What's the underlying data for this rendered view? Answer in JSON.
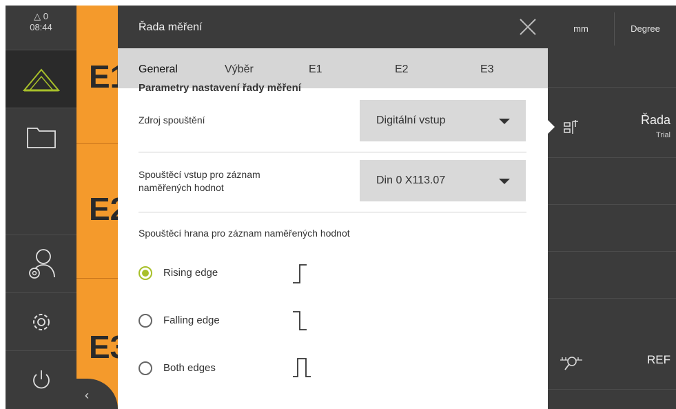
{
  "status": {
    "warnings": "0",
    "time": "08:44"
  },
  "main": {
    "labels": [
      "E1",
      "E2",
      "E3"
    ]
  },
  "right_panel": {
    "unit_button": "mm",
    "angle_button": "Degree",
    "series_label": "Řada",
    "series_sublabel": "Trial",
    "ref_label": "REF"
  },
  "dialog": {
    "title": "Řada měření",
    "tabs": [
      "General",
      "Výběr",
      "E1",
      "E2",
      "E3"
    ],
    "active_tab": "General",
    "partial_heading": "Parametry nastavení řady měření",
    "trigger_source": {
      "label": "Zdroj spouštění",
      "value": "Digitální vstup"
    },
    "trigger_input": {
      "label_line1": "Spouštěcí vstup pro záznam",
      "label_line2": "naměřených hodnot",
      "value": "Din 0 X113.07"
    },
    "edge_heading": "Spouštěcí hrana pro záznam naměřených hodnot",
    "edges": [
      {
        "label": "Rising edge",
        "selected": true
      },
      {
        "label": "Falling edge",
        "selected": false
      },
      {
        "label": "Both edges",
        "selected": false
      }
    ]
  },
  "colors": {
    "accent": "#f49a2c",
    "selected": "#a8c02a",
    "dark": "#3b3b3b"
  }
}
